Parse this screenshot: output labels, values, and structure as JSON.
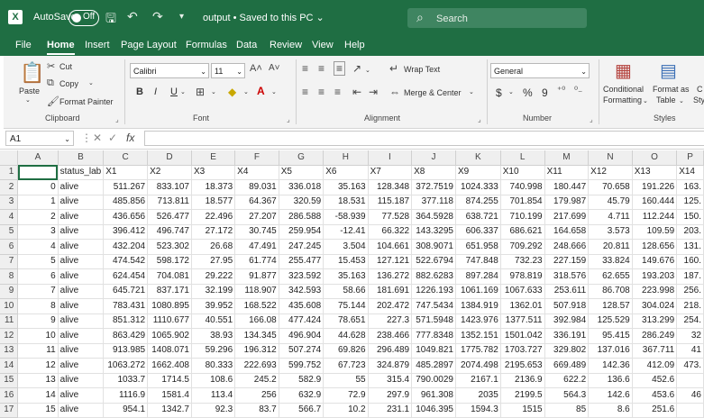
{
  "titlebar": {
    "logo": "X",
    "autosave_label": "AutoSave",
    "autosave_state": "Off",
    "title": "output • Saved to this PC",
    "search_placeholder": "Search",
    "icons": [
      "save-icon",
      "undo-icon",
      "redo-icon",
      "customize-quick-access-icon"
    ]
  },
  "tabs": [
    "File",
    "Home",
    "Insert",
    "Page Layout",
    "Formulas",
    "Data",
    "Review",
    "View",
    "Help"
  ],
  "active_tab": "Home",
  "ribbon": {
    "clipboard": {
      "label": "Clipboard",
      "paste": "Paste",
      "cut": "Cut",
      "copy": "Copy",
      "format_painter": "Format Painter"
    },
    "font": {
      "label": "Font",
      "font_name": "Calibri",
      "font_size": "11",
      "bold": "B",
      "italic": "I",
      "underline": "U"
    },
    "alignment": {
      "label": "Alignment",
      "wrap_text": "Wrap Text",
      "merge_center": "Merge & Center"
    },
    "number": {
      "label": "Number",
      "format": "General",
      "currency": "$",
      "percent": "%",
      "comma": "9"
    },
    "styles": {
      "label": "Styles",
      "conditional": "Conditional",
      "conditional2": "Formatting",
      "format_as": "Format as",
      "format_as2": "Table",
      "cell_styles": "C",
      "cell_styles2": "Sty"
    }
  },
  "formula_bar": {
    "name_box": "A1",
    "fx": "fx",
    "value": ""
  },
  "colors": {
    "accent": "#1f6e43",
    "ribbon_bg": "#f3f3f3"
  },
  "grid": {
    "columns": [
      "A",
      "B",
      "C",
      "D",
      "E",
      "F",
      "G",
      "H",
      "I",
      "J",
      "K",
      "L",
      "M",
      "N",
      "O",
      "P"
    ],
    "rows": [
      [
        "",
        "status_lab",
        "X1",
        "X2",
        "X3",
        "X4",
        "X5",
        "X6",
        "X7",
        "X8",
        "X9",
        "X10",
        "X11",
        "X12",
        "X13",
        "X14"
      ],
      [
        "0",
        "alive",
        "511.267",
        "833.107",
        "18.373",
        "89.031",
        "336.018",
        "35.163",
        "128.348",
        "372.7519",
        "1024.333",
        "740.998",
        "180.447",
        "70.658",
        "191.226",
        "163."
      ],
      [
        "1",
        "alive",
        "485.856",
        "713.811",
        "18.577",
        "64.367",
        "320.59",
        "18.531",
        "115.187",
        "377.118",
        "874.255",
        "701.854",
        "179.987",
        "45.79",
        "160.444",
        "125."
      ],
      [
        "2",
        "alive",
        "436.656",
        "526.477",
        "22.496",
        "27.207",
        "286.588",
        "-58.939",
        "77.528",
        "364.5928",
        "638.721",
        "710.199",
        "217.699",
        "4.711",
        "112.244",
        "150."
      ],
      [
        "3",
        "alive",
        "396.412",
        "496.747",
        "27.172",
        "30.745",
        "259.954",
        "-12.41",
        "66.322",
        "143.3295",
        "606.337",
        "686.621",
        "164.658",
        "3.573",
        "109.59",
        "203."
      ],
      [
        "4",
        "alive",
        "432.204",
        "523.302",
        "26.68",
        "47.491",
        "247.245",
        "3.504",
        "104.661",
        "308.9071",
        "651.958",
        "709.292",
        "248.666",
        "20.811",
        "128.656",
        "131."
      ],
      [
        "5",
        "alive",
        "474.542",
        "598.172",
        "27.95",
        "61.774",
        "255.477",
        "15.453",
        "127.121",
        "522.6794",
        "747.848",
        "732.23",
        "227.159",
        "33.824",
        "149.676",
        "160."
      ],
      [
        "6",
        "alive",
        "624.454",
        "704.081",
        "29.222",
        "91.877",
        "323.592",
        "35.163",
        "136.272",
        "882.6283",
        "897.284",
        "978.819",
        "318.576",
        "62.655",
        "193.203",
        "187."
      ],
      [
        "7",
        "alive",
        "645.721",
        "837.171",
        "32.199",
        "118.907",
        "342.593",
        "58.66",
        "181.691",
        "1226.193",
        "1061.169",
        "1067.633",
        "253.611",
        "86.708",
        "223.998",
        "256."
      ],
      [
        "8",
        "alive",
        "783.431",
        "1080.895",
        "39.952",
        "168.522",
        "435.608",
        "75.144",
        "202.472",
        "747.5434",
        "1384.919",
        "1362.01",
        "507.918",
        "128.57",
        "304.024",
        "218."
      ],
      [
        "9",
        "alive",
        "851.312",
        "1110.677",
        "40.551",
        "166.08",
        "477.424",
        "78.651",
        "227.3",
        "571.5948",
        "1423.976",
        "1377.511",
        "392.984",
        "125.529",
        "313.299",
        "254."
      ],
      [
        "10",
        "alive",
        "863.429",
        "1065.902",
        "38.93",
        "134.345",
        "496.904",
        "44.628",
        "238.466",
        "777.8348",
        "1352.151",
        "1501.042",
        "336.191",
        "95.415",
        "286.249",
        "32"
      ],
      [
        "11",
        "alive",
        "913.985",
        "1408.071",
        "59.296",
        "196.312",
        "507.274",
        "69.826",
        "296.489",
        "1049.821",
        "1775.782",
        "1703.727",
        "329.802",
        "137.016",
        "367.711",
        "41"
      ],
      [
        "12",
        "alive",
        "1063.272",
        "1662.408",
        "80.333",
        "222.693",
        "599.752",
        "67.723",
        "324.879",
        "485.2897",
        "2074.498",
        "2195.653",
        "669.489",
        "142.36",
        "412.09",
        "473."
      ],
      [
        "13",
        "alive",
        "1033.7",
        "1714.5",
        "108.6",
        "245.2",
        "582.9",
        "55",
        "315.4",
        "790.0029",
        "2167.1",
        "2136.9",
        "622.2",
        "136.6",
        "452.6",
        ""
      ],
      [
        "14",
        "alive",
        "1116.9",
        "1581.4",
        "113.4",
        "256",
        "632.9",
        "72.9",
        "297.9",
        "961.308",
        "2035",
        "2199.5",
        "564.3",
        "142.6",
        "453.6",
        "46"
      ],
      [
        "15",
        "alive",
        "954.1",
        "1342.7",
        "92.3",
        "83.7",
        "566.7",
        "10.2",
        "231.1",
        "1046.395",
        "1594.3",
        "1515",
        "85",
        "8.6",
        "251.6",
        ""
      ]
    ]
  }
}
